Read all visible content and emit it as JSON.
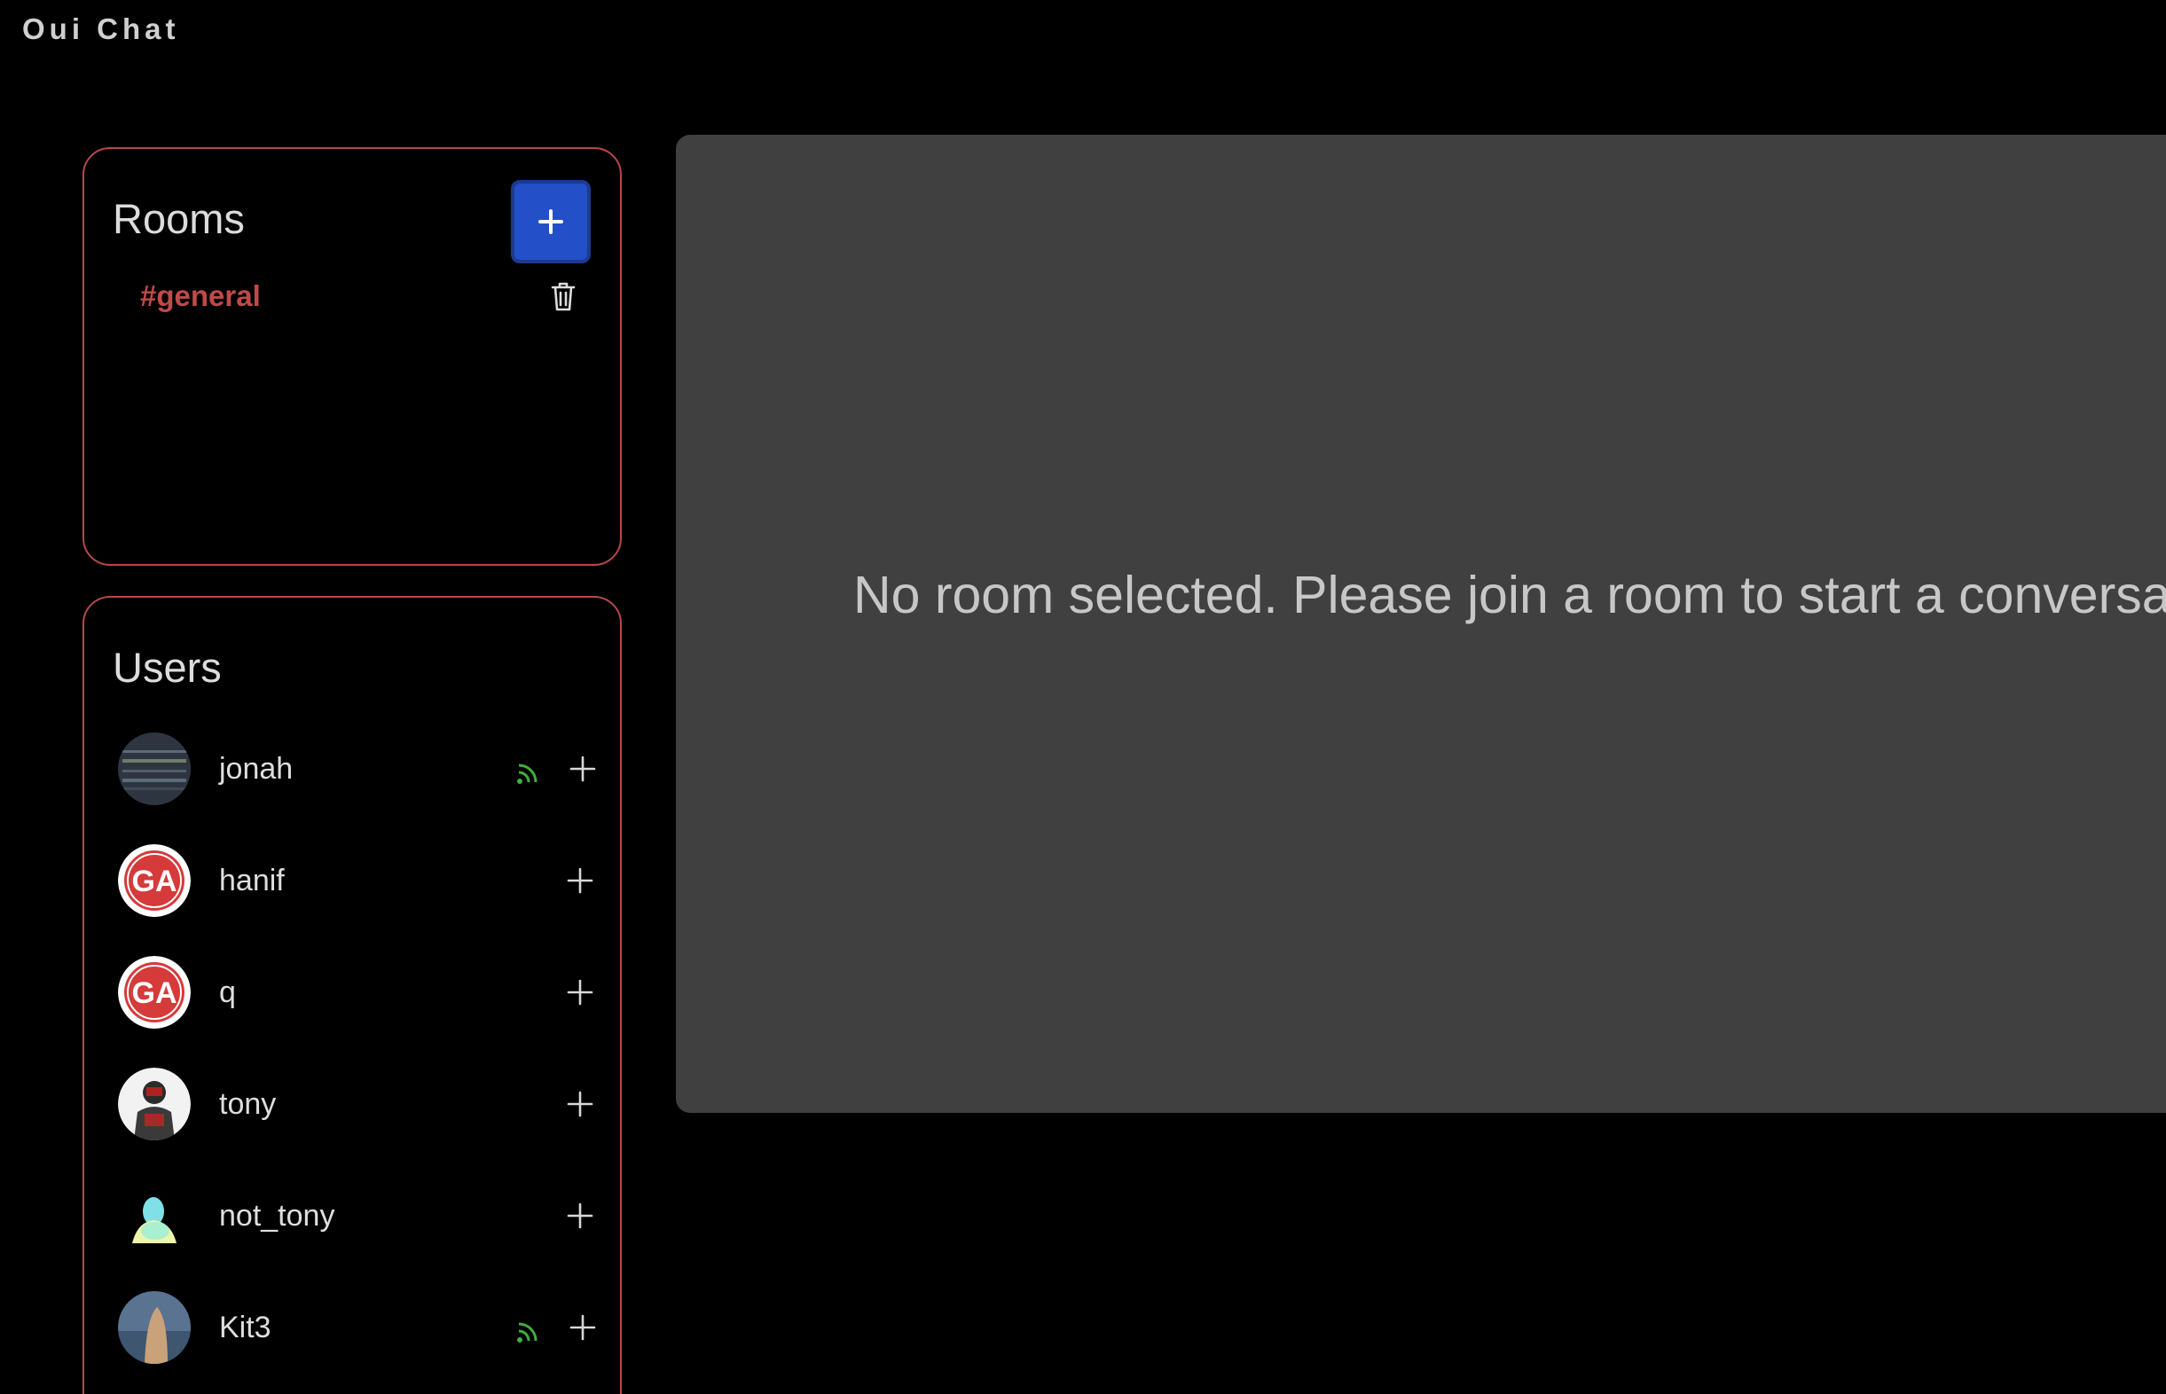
{
  "app": {
    "title": "Oui Chat"
  },
  "rooms": {
    "title": "Rooms",
    "add_icon": "plus-icon",
    "items": [
      {
        "label": "#general",
        "delete_icon": "trash-icon"
      }
    ]
  },
  "users": {
    "title": "Users",
    "items": [
      {
        "name": "jonah",
        "online": true
      },
      {
        "name": "hanif",
        "online": false
      },
      {
        "name": "q",
        "online": false
      },
      {
        "name": "tony",
        "online": false
      },
      {
        "name": "not_tony",
        "online": false
      },
      {
        "name": "Kit3",
        "online": true
      }
    ]
  },
  "main": {
    "empty_message": "No room selected. Please join a room to start a conversation."
  },
  "colors": {
    "accent_border": "#b84848",
    "room_text": "#c04a4a",
    "button_blue": "#2350c8",
    "online_green": "#3fae3f",
    "panel_bg": "#404040"
  }
}
